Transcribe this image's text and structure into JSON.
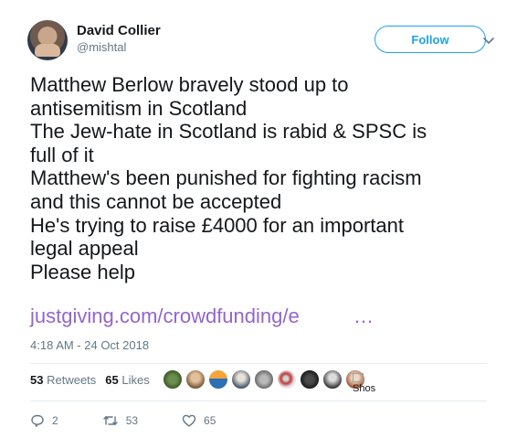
{
  "author": {
    "display_name": "David Collier",
    "screen_name": "@mishtal"
  },
  "follow_label": "Follow",
  "tweet": {
    "lines": [
      "Matthew Berlow bravely stood up to",
      "antisemitism in Scotland",
      "The Jew-hate in Scotland is rabid & SPSC is",
      "full of it",
      "Matthew's been punished for fighting racism",
      "and this cannot be accepted",
      "He's trying to raise £4000 for an important",
      "legal appeal",
      "Please help"
    ],
    "link_text": "justgiving.com/crowdfunding/e",
    "link_ellipsis": "…"
  },
  "timestamp": "4:18 AM - 24 Oct 2018",
  "stats": {
    "retweets_count": "53",
    "retweets_label": "Retweets",
    "likes_count": "65",
    "likes_label": "Likes"
  },
  "likers_broken_image_alt": "Shos",
  "actions": {
    "reply_count": "2",
    "retweet_count": "53",
    "like_count": "65"
  },
  "colors": {
    "link": "#9266cc",
    "follow": "#1da1f2",
    "secondary_text": "#657786"
  }
}
